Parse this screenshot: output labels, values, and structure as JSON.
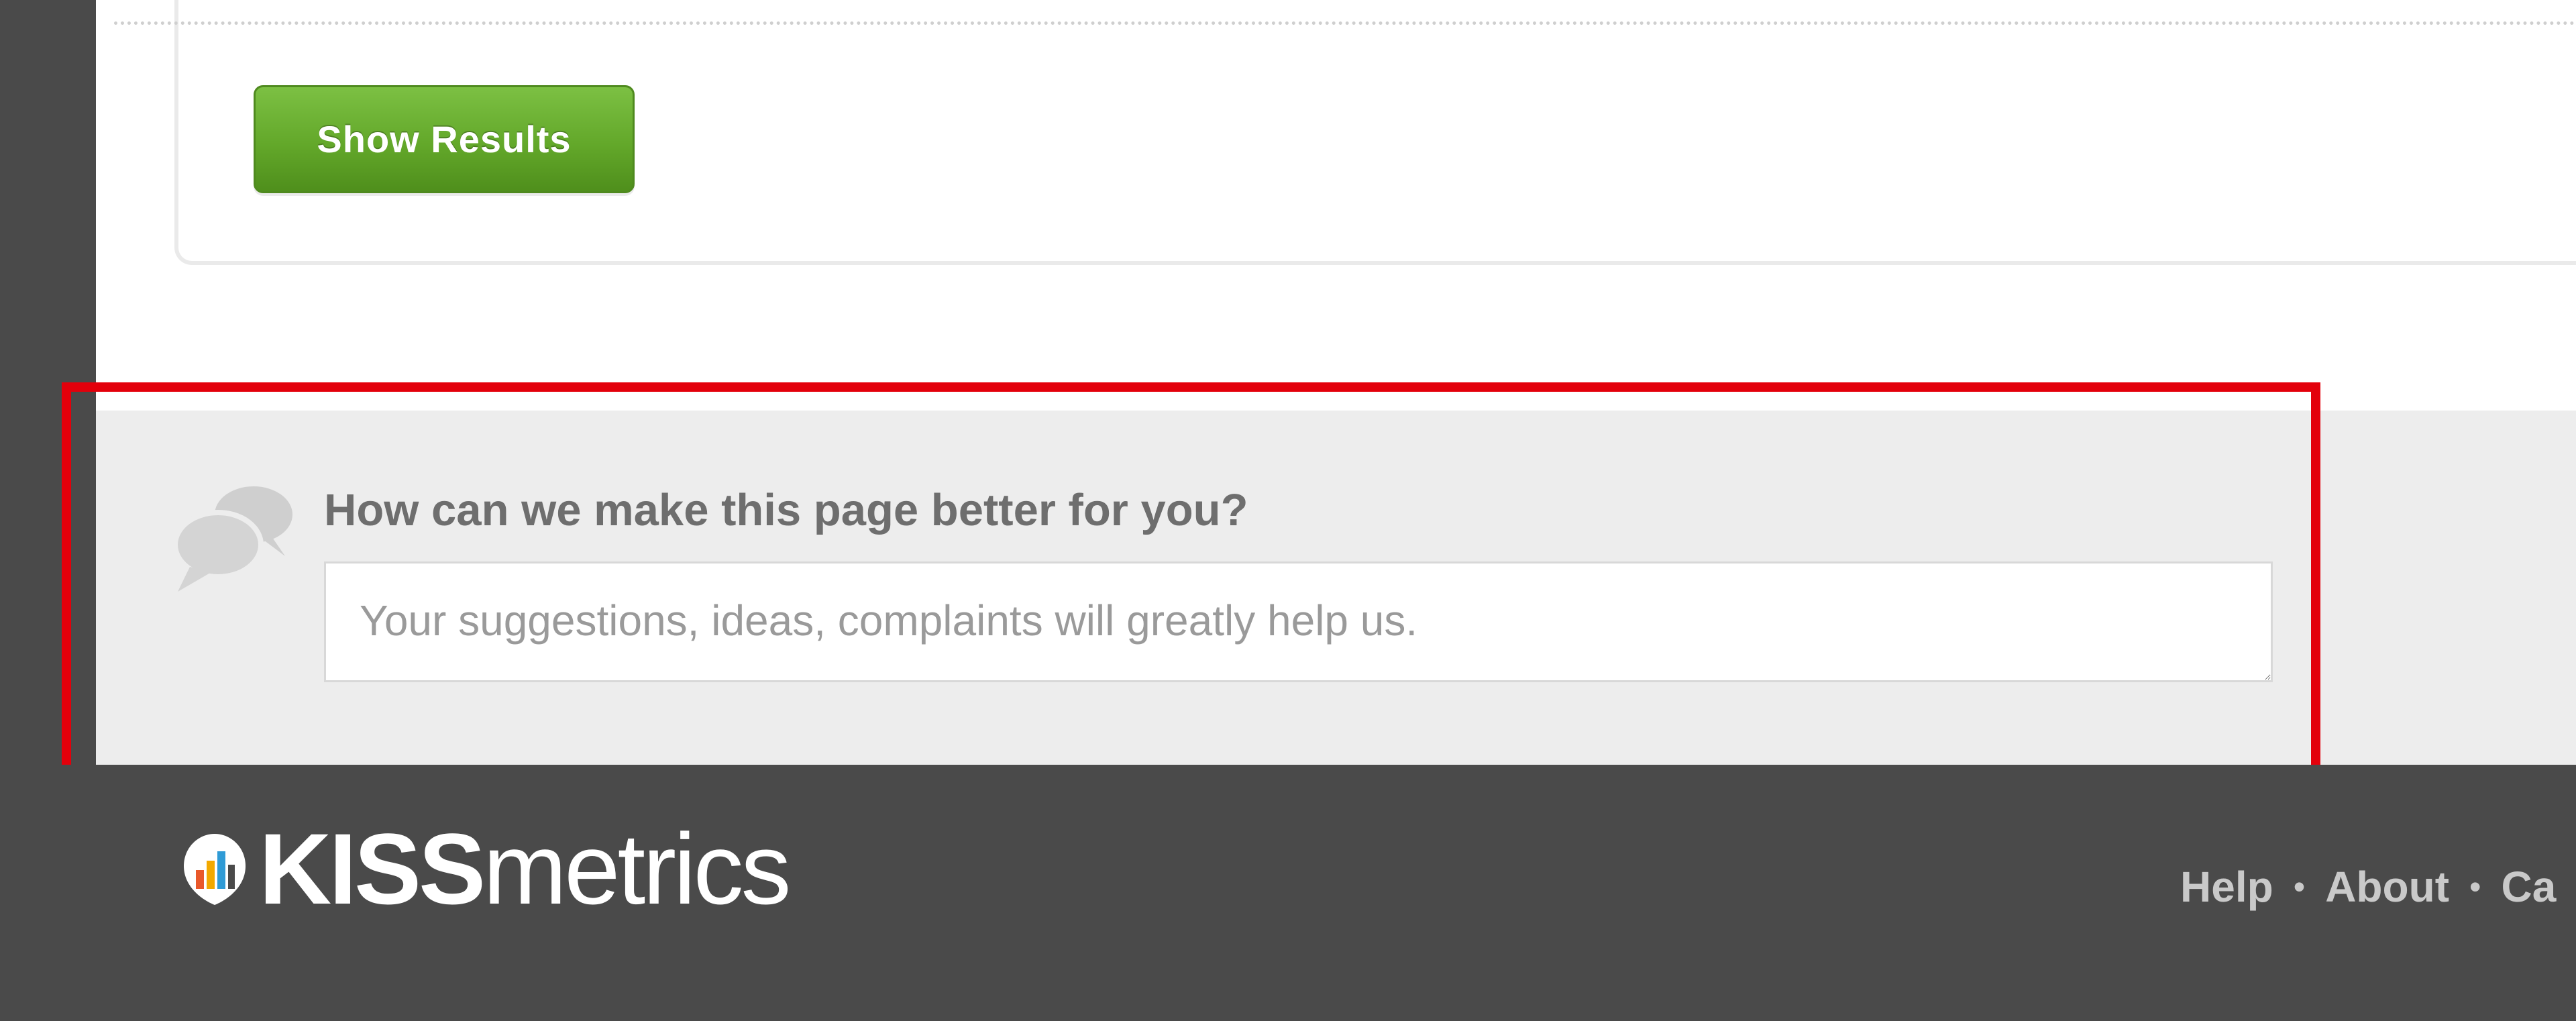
{
  "results": {
    "show_results_label": "Show Results"
  },
  "feedback": {
    "question": "How can we make this page better for you?",
    "input_placeholder": "Your suggestions, ideas, complaints will greatly help us.",
    "input_value": ""
  },
  "footer": {
    "logo_bold": "KISS",
    "logo_rest": "metrics",
    "links": [
      "Help",
      "About",
      "Ca"
    ],
    "separator": "•"
  },
  "colors": {
    "button_green": "#63a82a",
    "highlight_red": "#e3000b",
    "footer_bg": "#4a4a4a",
    "feedback_bg": "#ededed"
  },
  "icons": [
    "chat-bubbles-icon",
    "kissmetrics-logo-icon",
    "resize-handle-icon"
  ]
}
